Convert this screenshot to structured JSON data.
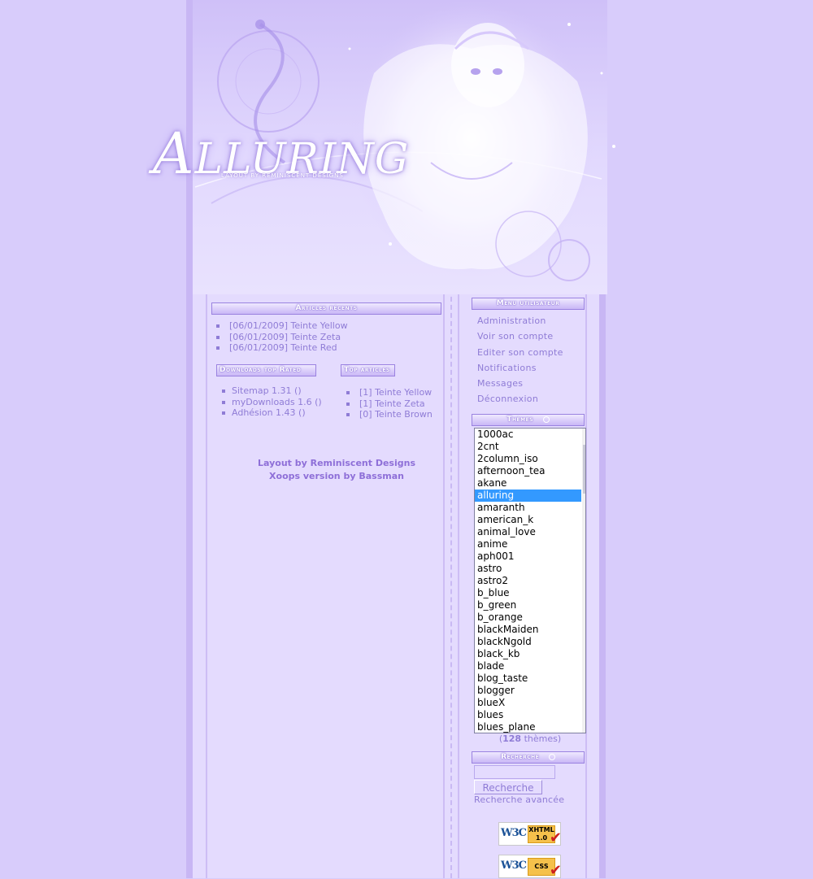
{
  "header": {
    "logo_first": "A",
    "logo_rest": "LLURING",
    "logo_tagline": "LAYOUT BY REMINISCENT DESIGNS"
  },
  "left_blocks": {
    "recent": {
      "title": "Articles récents",
      "items": [
        "[06/01/2009] Teinte Yellow",
        "[06/01/2009] Teinte Zeta",
        "[06/01/2009] Teinte Red"
      ]
    },
    "downloads": {
      "title": "Downloads top Rated",
      "items": [
        "Sitemap 1.31 ()",
        "myDownloads 1.6 ()",
        "Adhésion 1.43 ()"
      ]
    },
    "top": {
      "title": "Top articles",
      "items": [
        "[1] Teinte Yellow",
        "[1] Teinte Zeta",
        "[0] Teinte Brown"
      ]
    }
  },
  "credits": {
    "line1": "Layout by Reminiscent Designs",
    "line2": "Xoops version by Bassman"
  },
  "user_menu": {
    "title": "Menu utilisateur",
    "items": [
      "Administration",
      "Voir son compte",
      "Editer son compte",
      "Notifications",
      "Messages",
      "Déconnexion"
    ]
  },
  "themes": {
    "title": "Thèmes",
    "selected": "alluring",
    "options": [
      "1000ac",
      "2cnt",
      "2column_iso",
      "afternoon_tea",
      "akane",
      "alluring",
      "amaranth",
      "american_k",
      "animal_love",
      "anime",
      "aph001",
      "astro",
      "astro2",
      "b_blue",
      "b_green",
      "b_orange",
      "blackMaiden",
      "blackNgold",
      "black_kb",
      "blade",
      "blog_taste",
      "blogger",
      "blueX",
      "blues",
      "blues_plane"
    ],
    "count_open": "(",
    "count": "128",
    "count_suffix": " thèmes)"
  },
  "search": {
    "title": "Recherche",
    "button_label": "Recherche",
    "advanced_label": "Recherche avancée",
    "input_value": ""
  },
  "badges": {
    "xhtml": {
      "w3c": "W3C",
      "label_top": "XHTML",
      "label_bottom": "1.0"
    },
    "css": {
      "w3c": "W3C",
      "label_top": "CSS",
      "label_bottom": ""
    }
  },
  "colors": {
    "page_bg": "#d8ccfb",
    "content_bg": "#e4dbfe",
    "accent_text": "#8f7cd6",
    "selected_option": "#3399ff"
  }
}
